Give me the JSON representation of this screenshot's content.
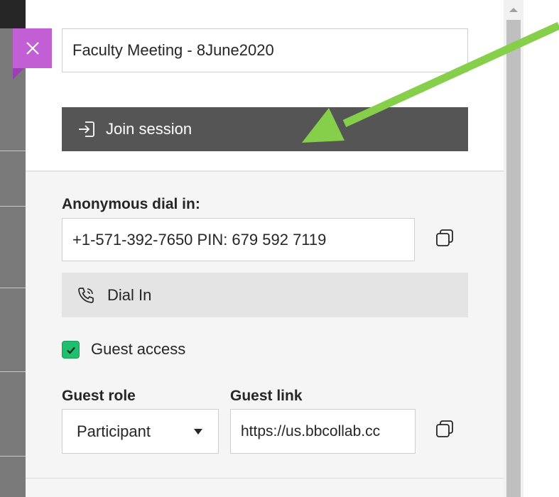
{
  "session": {
    "name_value": "Faculty Meeting - 8June2020",
    "join_label": "Join session"
  },
  "dial": {
    "heading": "Anonymous dial in:",
    "number_value": "+1-571-392-7650 PIN: 679 592 7119",
    "dial_in_label": "Dial In"
  },
  "guest": {
    "access_label": "Guest access",
    "access_checked": true,
    "role_heading": "Guest role",
    "role_selected": "Participant",
    "link_heading": "Guest link",
    "link_value": "https://us.bbcollab.cc"
  },
  "colors": {
    "close_accent": "#c25fd4",
    "join_button": "#555555",
    "checkbox_green": "#1fbf6f",
    "annotation_arrow": "#86cf4b"
  },
  "icons": {
    "close": "close-icon",
    "join": "sign-in-icon",
    "phone": "phone-icon",
    "copy": "copy-icon",
    "check": "check-icon",
    "dropdown": "chevron-down-icon",
    "scroll_up": "scroll-up-icon"
  }
}
